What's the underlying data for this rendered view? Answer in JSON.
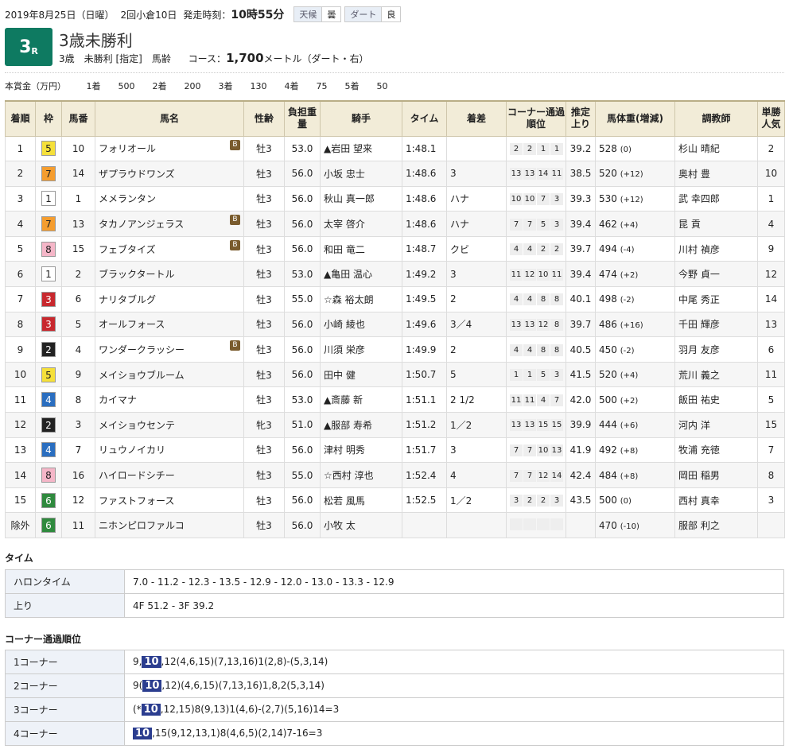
{
  "header": {
    "date": "2019年8月25日（日曜）",
    "meeting": "2回小倉10日",
    "start_label": "発走時刻：",
    "start_time": "10時55分",
    "weather_label": "天候",
    "weather": "曇",
    "track_label": "ダート",
    "track_cond": "良"
  },
  "race": {
    "num": "3",
    "num_suffix": "R",
    "title": "3歳未勝利",
    "conditions": "3歳　未勝利 [指定]　馬齢",
    "course_label": "コース：",
    "distance": "1,700",
    "distance_unit": "メートル（ダート・右）"
  },
  "prize": {
    "label": "本賞金（万円）",
    "items": [
      "1着",
      "500",
      "2着",
      "200",
      "3着",
      "130",
      "4着",
      "75",
      "5着",
      "50"
    ]
  },
  "columns": [
    "着順",
    "枠",
    "馬番",
    "馬名",
    "性齢",
    "負担重量",
    "騎手",
    "タイム",
    "着差",
    "コーナー通過順位",
    "推定上り",
    "馬体重(増減)",
    "調教師",
    "単勝人気"
  ],
  "rows": [
    {
      "pos": "1",
      "waku": "5",
      "num": "10",
      "name": "フォリオール",
      "blink": "B",
      "sex": "牡3",
      "wt": "53.0",
      "jockey": "▲岩田 望来",
      "time": "1:48.1",
      "margin": "",
      "corners": [
        "2",
        "2",
        "1",
        "1"
      ],
      "last": "39.2",
      "bw": "528",
      "bd": "(0)",
      "trainer": "杉山 晴紀",
      "pop": "2"
    },
    {
      "pos": "2",
      "waku": "7",
      "num": "14",
      "name": "ザプラウドワンズ",
      "blink": "",
      "sex": "牡3",
      "wt": "56.0",
      "jockey": "小坂 忠士",
      "time": "1:48.6",
      "margin": "3",
      "corners": [
        "13",
        "13",
        "14",
        "11"
      ],
      "last": "38.5",
      "bw": "520",
      "bd": "(+12)",
      "trainer": "奥村 豊",
      "pop": "10"
    },
    {
      "pos": "3",
      "waku": "1",
      "num": "1",
      "name": "メメランタン",
      "blink": "",
      "sex": "牡3",
      "wt": "56.0",
      "jockey": "秋山 真一郎",
      "time": "1:48.6",
      "margin": "ハナ",
      "corners": [
        "10",
        "10",
        "7",
        "3"
      ],
      "last": "39.3",
      "bw": "530",
      "bd": "(+12)",
      "trainer": "武 幸四郎",
      "pop": "1"
    },
    {
      "pos": "4",
      "waku": "7",
      "num": "13",
      "name": "タカノアンジェラス",
      "blink": "B",
      "sex": "牡3",
      "wt": "56.0",
      "jockey": "太宰 啓介",
      "time": "1:48.6",
      "margin": "ハナ",
      "corners": [
        "7",
        "7",
        "5",
        "3"
      ],
      "last": "39.4",
      "bw": "462",
      "bd": "(+4)",
      "trainer": "昆 貢",
      "pop": "4"
    },
    {
      "pos": "5",
      "waku": "8",
      "num": "15",
      "name": "フェブタイズ",
      "blink": "B",
      "sex": "牡3",
      "wt": "56.0",
      "jockey": "和田 竜二",
      "time": "1:48.7",
      "margin": "クビ",
      "corners": [
        "4",
        "4",
        "2",
        "2"
      ],
      "last": "39.7",
      "bw": "494",
      "bd": "(-4)",
      "trainer": "川村 禎彦",
      "pop": "9"
    },
    {
      "pos": "6",
      "waku": "1",
      "num": "2",
      "name": "ブラックタートル",
      "blink": "",
      "sex": "牡3",
      "wt": "53.0",
      "jockey": "▲亀田 温心",
      "time": "1:49.2",
      "margin": "3",
      "corners": [
        "11",
        "12",
        "10",
        "11"
      ],
      "last": "39.4",
      "bw": "474",
      "bd": "(+2)",
      "trainer": "今野 貞一",
      "pop": "12"
    },
    {
      "pos": "7",
      "waku": "3",
      "num": "6",
      "name": "ナリタブルグ",
      "blink": "",
      "sex": "牡3",
      "wt": "55.0",
      "jockey": "☆森 裕太朗",
      "time": "1:49.5",
      "margin": "2",
      "corners": [
        "4",
        "4",
        "8",
        "8"
      ],
      "last": "40.1",
      "bw": "498",
      "bd": "(-2)",
      "trainer": "中尾 秀正",
      "pop": "14"
    },
    {
      "pos": "8",
      "waku": "3",
      "num": "5",
      "name": "オールフォース",
      "blink": "",
      "sex": "牡3",
      "wt": "56.0",
      "jockey": "小崎 綾也",
      "time": "1:49.6",
      "margin": "3／4",
      "corners": [
        "13",
        "13",
        "12",
        "8"
      ],
      "last": "39.7",
      "bw": "486",
      "bd": "(+16)",
      "trainer": "千田 輝彦",
      "pop": "13"
    },
    {
      "pos": "9",
      "waku": "2",
      "num": "4",
      "name": "ワンダークラッシー",
      "blink": "B",
      "sex": "牡3",
      "wt": "56.0",
      "jockey": "川須 栄彦",
      "time": "1:49.9",
      "margin": "2",
      "corners": [
        "4",
        "4",
        "8",
        "8"
      ],
      "last": "40.5",
      "bw": "450",
      "bd": "(-2)",
      "trainer": "羽月 友彦",
      "pop": "6"
    },
    {
      "pos": "10",
      "waku": "5",
      "num": "9",
      "name": "メイショウブルーム",
      "blink": "",
      "sex": "牡3",
      "wt": "56.0",
      "jockey": "田中 健",
      "time": "1:50.7",
      "margin": "5",
      "corners": [
        "1",
        "1",
        "5",
        "3"
      ],
      "last": "41.5",
      "bw": "520",
      "bd": "(+4)",
      "trainer": "荒川 義之",
      "pop": "11"
    },
    {
      "pos": "11",
      "waku": "4",
      "num": "8",
      "name": "カイマナ",
      "blink": "",
      "sex": "牡3",
      "wt": "53.0",
      "jockey": "▲斎藤 新",
      "time": "1:51.1",
      "margin": "2 1/2",
      "corners": [
        "11",
        "11",
        "4",
        "7"
      ],
      "last": "42.0",
      "bw": "500",
      "bd": "(+2)",
      "trainer": "飯田 祐史",
      "pop": "5"
    },
    {
      "pos": "12",
      "waku": "2",
      "num": "3",
      "name": "メイショウセンテ",
      "blink": "",
      "sex": "牝3",
      "wt": "51.0",
      "jockey": "▲服部 寿希",
      "time": "1:51.2",
      "margin": "1／2",
      "corners": [
        "13",
        "13",
        "15",
        "15"
      ],
      "last": "39.9",
      "bw": "444",
      "bd": "(+6)",
      "trainer": "河内 洋",
      "pop": "15"
    },
    {
      "pos": "13",
      "waku": "4",
      "num": "7",
      "name": "リュウノイカリ",
      "blink": "",
      "sex": "牡3",
      "wt": "56.0",
      "jockey": "津村 明秀",
      "time": "1:51.7",
      "margin": "3",
      "corners": [
        "7",
        "7",
        "10",
        "13"
      ],
      "last": "41.9",
      "bw": "492",
      "bd": "(+8)",
      "trainer": "牧浦 充徳",
      "pop": "7"
    },
    {
      "pos": "14",
      "waku": "8",
      "num": "16",
      "name": "ハイロードシチー",
      "blink": "",
      "sex": "牡3",
      "wt": "55.0",
      "jockey": "☆西村 淳也",
      "time": "1:52.4",
      "margin": "4",
      "corners": [
        "7",
        "7",
        "12",
        "14"
      ],
      "last": "42.4",
      "bw": "484",
      "bd": "(+8)",
      "trainer": "岡田 稲男",
      "pop": "8"
    },
    {
      "pos": "15",
      "waku": "6",
      "num": "12",
      "name": "ファストフォース",
      "blink": "",
      "sex": "牡3",
      "wt": "56.0",
      "jockey": "松若 風馬",
      "time": "1:52.5",
      "margin": "1／2",
      "corners": [
        "3",
        "2",
        "2",
        "3"
      ],
      "last": "43.5",
      "bw": "500",
      "bd": "(0)",
      "trainer": "西村 真幸",
      "pop": "3"
    },
    {
      "pos": "除外",
      "waku": "6",
      "num": "11",
      "name": "ニホンピロファルコ",
      "blink": "",
      "sex": "牡3",
      "wt": "56.0",
      "jockey": "小牧 太",
      "time": "",
      "margin": "",
      "corners": [
        "",
        "",
        "",
        ""
      ],
      "last": "",
      "bw": "470",
      "bd": "(-10)",
      "trainer": "服部 利之",
      "pop": ""
    }
  ],
  "time_section": {
    "title": "タイム",
    "rows": [
      {
        "label": "ハロンタイム",
        "value": "7.0 - 11.2 - 12.3 - 13.5 - 12.9 - 12.0 - 13.0 - 13.3 - 12.9"
      },
      {
        "label": "上り",
        "value": "4F 51.2 - 3F 39.2"
      }
    ]
  },
  "corner_section": {
    "title": "コーナー通過順位",
    "rows": [
      {
        "label": "1コーナー",
        "pre": "9,",
        "hl": "10",
        "post": ",12(4,6,15)(7,13,16)1(2,8)-(5,3,14)"
      },
      {
        "label": "2コーナー",
        "pre": "9(",
        "hl": "10",
        "post": ",12)(4,6,15)(7,13,16)1,8,2(5,3,14)"
      },
      {
        "label": "3コーナー",
        "pre": "(*",
        "hl": "10",
        "post": ",12,15)8(9,13)1(4,6)-(2,7)(5,16)14=3"
      },
      {
        "label": "4コーナー",
        "pre": "",
        "hl": "10",
        "post": ",15(9,12,13,1)8(4,6,5)(2,14)7-16=3"
      }
    ]
  }
}
